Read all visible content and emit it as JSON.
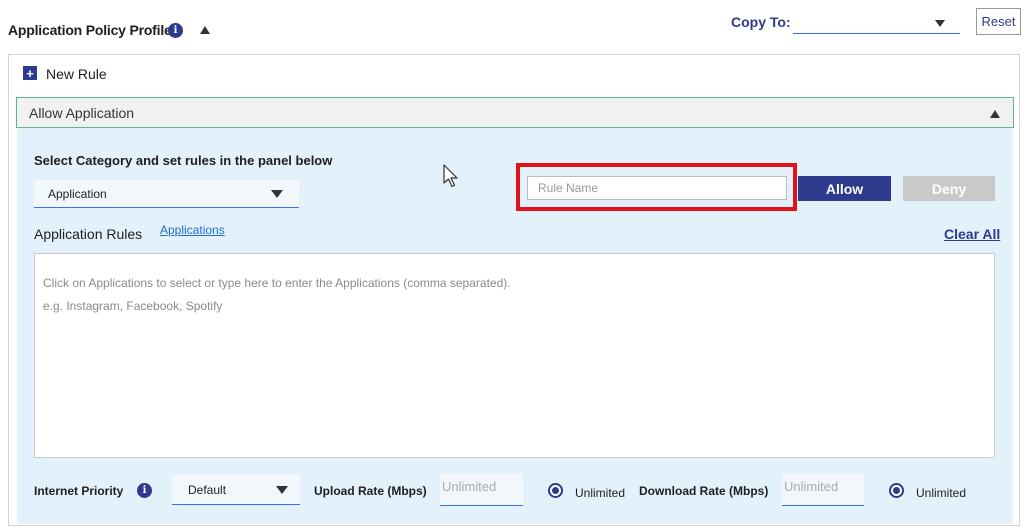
{
  "header": {
    "title": "Application Policy Profile",
    "info_icon": "info-icon",
    "collapse_icon": "triangle-up-icon",
    "copy_to_label": "Copy To:",
    "copy_to_value": "",
    "reset_label": "Reset"
  },
  "new_rule": {
    "label": "New Rule",
    "icon": "plus-icon"
  },
  "accordion": {
    "label": "Allow Application",
    "icon": "triangle-up-icon"
  },
  "panel": {
    "select_category_label": "Select Category and set rules in the panel below",
    "category_value": "Application",
    "rule_name_placeholder": "Rule Name",
    "allow_label": "Allow",
    "deny_label": "Deny",
    "application_rules_label": "Application Rules",
    "applications_link": "Applications",
    "clear_all_label": "Clear All",
    "textarea_hint_line1": "Click on Applications to select or type here to enter the Applications (comma separated).",
    "textarea_hint_line2": "e.g. Instagram, Facebook, Spotify"
  },
  "footer": {
    "internet_priority_label": "Internet Priority",
    "priority_value": "Default",
    "upload_label": "Upload Rate (Mbps)",
    "upload_placeholder": "Unlimited",
    "upload_unlimited_label": "Unlimited",
    "download_label": "Download Rate (Mbps)",
    "download_placeholder": "Unlimited",
    "download_unlimited_label": "Unlimited"
  },
  "colors": {
    "brand": "#2e3a8c",
    "highlight": "#e0131a",
    "panel_bg": "#e3f1fa",
    "accordion_border": "#5db58a",
    "link": "#1f6fd1"
  }
}
